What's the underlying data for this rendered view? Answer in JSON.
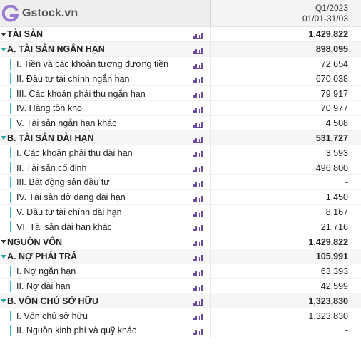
{
  "brand": {
    "name": "Gstock.vn",
    "accent": "#9a7bd0"
  },
  "period": {
    "quarter": "Q1/2023",
    "range": "01/01-31/03"
  },
  "rows": [
    {
      "type": "section",
      "label": "TÀI SẢN",
      "value": "1,429,822"
    },
    {
      "type": "group",
      "label": "A. TÀI SẢN NGẮN HẠN",
      "value": "898,095"
    },
    {
      "type": "item",
      "label": "I. Tiền và các khoản tương đương tiền",
      "value": "72,654"
    },
    {
      "type": "item",
      "label": "II. Đầu tư tài chính ngắn hạn",
      "value": "670,038"
    },
    {
      "type": "item",
      "label": "III. Các khoản phải thu ngắn hạn",
      "value": "79,917"
    },
    {
      "type": "item",
      "label": "IV. Hàng tồn kho",
      "value": "70,977"
    },
    {
      "type": "item",
      "label": "V. Tài sản ngắn hạn khác",
      "value": "4,508"
    },
    {
      "type": "group",
      "label": "B. TÀI SẢN DÀI HẠN",
      "value": "531,727"
    },
    {
      "type": "item",
      "label": "I. Các khoản phải thu dài hạn",
      "value": "3,593"
    },
    {
      "type": "item",
      "label": "II. Tài sản cố định",
      "value": "496,800"
    },
    {
      "type": "item",
      "label": "III. Bất động sản đầu tư",
      "value": "-"
    },
    {
      "type": "item",
      "label": "IV. Tài sản dở dang dài hạn",
      "value": "1,450"
    },
    {
      "type": "item",
      "label": "V. Đầu tư tài chính dài hạn",
      "value": "8,167"
    },
    {
      "type": "item",
      "label": "VI. Tài sản dài hạn khác",
      "value": "21,716"
    },
    {
      "type": "section",
      "label": "NGUỒN VỐN",
      "value": "1,429,822"
    },
    {
      "type": "group",
      "label": "A. NỢ PHẢI TRẢ",
      "value": "105,991"
    },
    {
      "type": "item",
      "label": "I. Nợ ngắn hạn",
      "value": "63,393"
    },
    {
      "type": "item",
      "label": "II. Nợ dài hạn",
      "value": "42,599"
    },
    {
      "type": "group",
      "label": "B. VỐN CHỦ SỞ HỮU",
      "value": "1,323,830"
    },
    {
      "type": "item",
      "label": "I. Vốn chủ sở hữu",
      "value": "1,323,830"
    },
    {
      "type": "item",
      "label": "II. Nguồn kinh phí và quỹ khác",
      "value": "-"
    }
  ],
  "icons": {
    "row_action": "bar-chart-icon",
    "toggle_section": "caret-down-icon",
    "toggle_group": "caret-down-teal-icon"
  }
}
